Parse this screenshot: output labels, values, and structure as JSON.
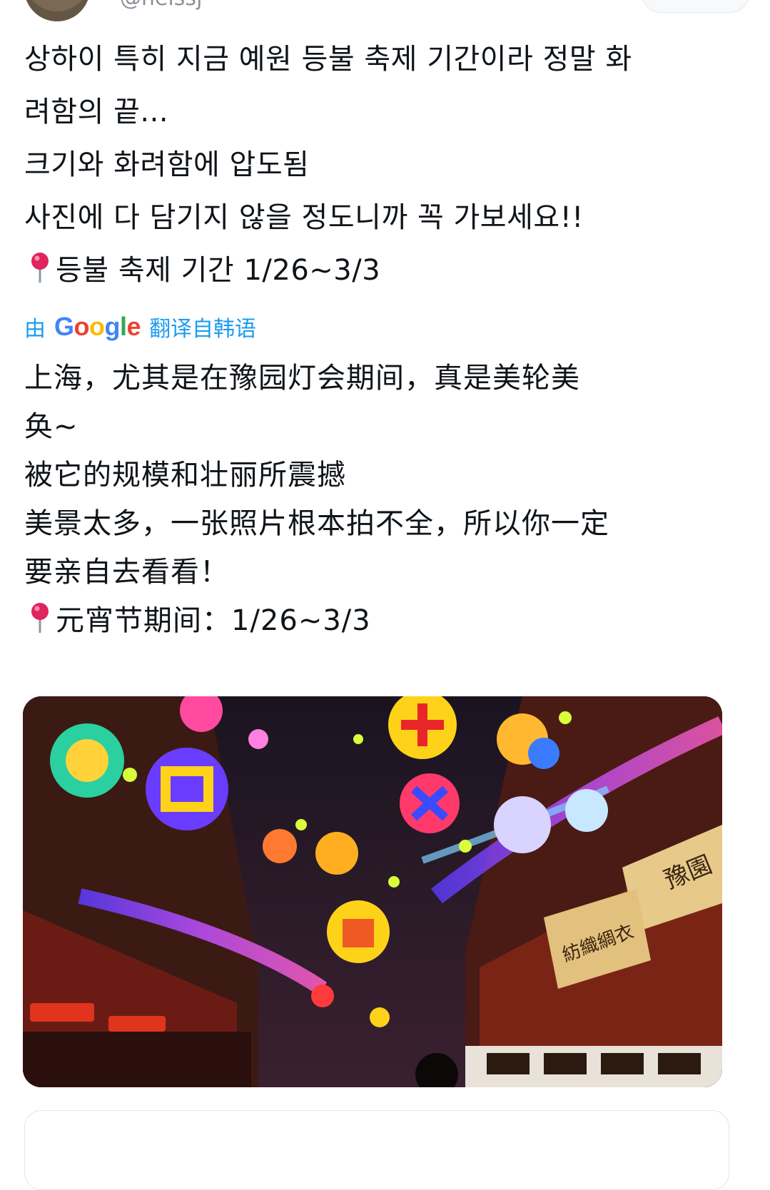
{
  "header": {
    "handle": "@neissj"
  },
  "tweet": {
    "original_text": "상하이 특히 지금 예원 등불 축제 기간이라 정말 화\n려함의 끝...\n크기와 화려함에 압도됨\n사진에 다 담기지 않을 정도니까 꼭 가보세요!!",
    "original_date_line": "등불 축제 기간 1/26~3/3",
    "pin_icon": "round-pushpin-icon"
  },
  "translation": {
    "prefix": "由",
    "provider": "Google",
    "suffix": "翻译自韩语",
    "text": "上海，尤其是在豫园灯会期间，真是美轮美\n奂~\n被它的规模和壮丽所震撼\n美景太多，一张照片根本拍不全，所以你一定\n要亲自去看看！",
    "date_line": "元宵节期间：1/26~3/3"
  },
  "media": {
    "sign_right": "豫園",
    "sign_lower": "紡織綢衣"
  },
  "colors": {
    "link": "#1d9bf0",
    "text": "#0f1419",
    "pin": "#e0245e"
  }
}
